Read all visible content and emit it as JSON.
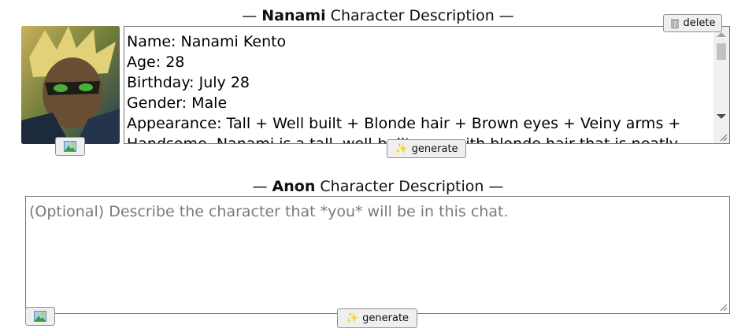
{
  "character": {
    "heading_dash_left": "—",
    "heading_name": "Nanami",
    "heading_rest": " Character Description",
    "heading_dash_right": "—",
    "delete_label": "delete",
    "delete_icon": "trash-icon",
    "generate_label": "generate",
    "generate_icon": "sparkles-icon",
    "avatar_icon": "picture-icon",
    "description": "Name: Nanami Kento\nAge: 28\nBirthday: July 28\nGender: Male\nAppearance: Tall + Well built + Blonde hair + Brown eyes + Veiny arms +\nHandsome. Nanami is a tall, well-built man with blonde hair that is neatly"
  },
  "user": {
    "heading_dash_left": "—",
    "heading_name": "Anon",
    "heading_rest": " Character Description",
    "heading_dash_right": "—",
    "placeholder": "(Optional) Describe the character that *you* will be in this chat.",
    "generate_label": "generate",
    "generate_icon": "sparkles-icon",
    "avatar_icon": "picture-icon"
  },
  "colors": {
    "button_bg": "#efefef",
    "border": "#767676",
    "placeholder": "#7a7a7a"
  }
}
